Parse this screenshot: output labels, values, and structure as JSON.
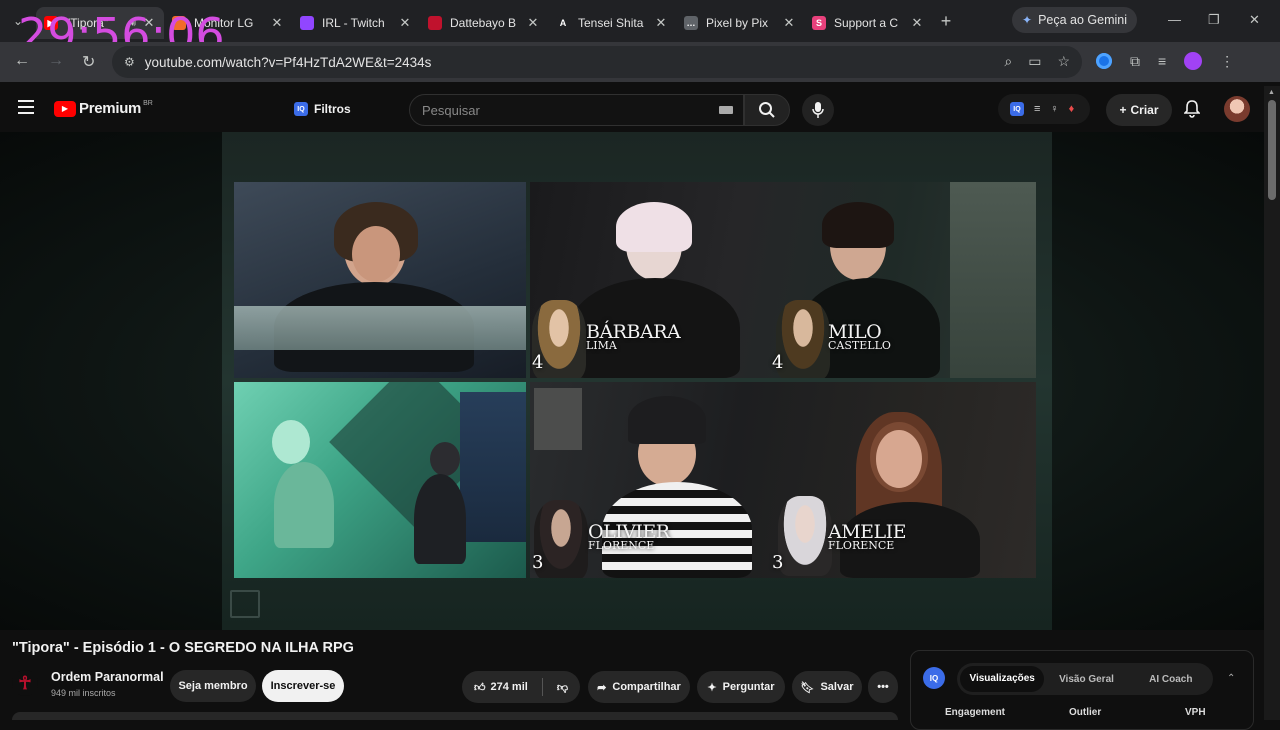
{
  "overlay": {
    "timer": "29:56:06"
  },
  "browser": {
    "tabs": [
      {
        "title": "\"Tipora\"",
        "favicon_color": "#ff0000",
        "favicon_glyph": "▶",
        "active": true,
        "audio": true
      },
      {
        "title": "Monitor LG",
        "favicon_color": "#f26b2a",
        "favicon_glyph": "",
        "active": false
      },
      {
        "title": "IRL - Twitch",
        "favicon_color": "#9146ff",
        "favicon_glyph": "",
        "active": false
      },
      {
        "title": "Dattebayo B",
        "favicon_color": "#c0122d",
        "favicon_glyph": "",
        "active": false
      },
      {
        "title": "Tensei Shita",
        "favicon_color": "#202124",
        "favicon_glyph": "A",
        "active": false
      },
      {
        "title": "Pixel by Pix",
        "favicon_color": "#5f6368",
        "favicon_glyph": "…",
        "active": false
      },
      {
        "title": "Support a C",
        "favicon_color": "#e8417c",
        "favicon_glyph": "S",
        "active": false
      }
    ],
    "gemini_label": "Peça ao Gemini",
    "url": "youtube.com/watch?v=Pf4HzTdA2WE&t=2434s"
  },
  "youtube": {
    "logo_text": "Premium",
    "country": "BR",
    "filters_label": "Filtros",
    "search_placeholder": "Pesquisar",
    "create_label": "Criar",
    "iq_label": "IQ"
  },
  "video_overlay": {
    "characters": [
      {
        "first": "BÁRBARA",
        "last": "LIMA",
        "number": "4"
      },
      {
        "first": "MILO",
        "last": "CASTELLO",
        "number": "4"
      },
      {
        "first": "OLIVIER",
        "last": "FLORENCE",
        "number": "3"
      },
      {
        "first": "AMELIE",
        "last": "FLORENCE",
        "number": "3"
      }
    ]
  },
  "watch": {
    "title": "\"Tipora\" - Episódio 1 - O SEGREDO NA ILHA RPG",
    "channel_name": "Ordem Paranormal",
    "subscribers": "949 mil inscritos",
    "join_label": "Seja membro",
    "subscribe_label": "Inscrever-se",
    "likes": "274 mil",
    "share_label": "Compartilhar",
    "ask_label": "Perguntar",
    "save_label": "Salvar"
  },
  "side_panel": {
    "tabs": [
      "Visualizações",
      "Visão Geral",
      "AI Coach"
    ],
    "metrics": [
      "Engagement",
      "Outlier",
      "VPH"
    ]
  }
}
